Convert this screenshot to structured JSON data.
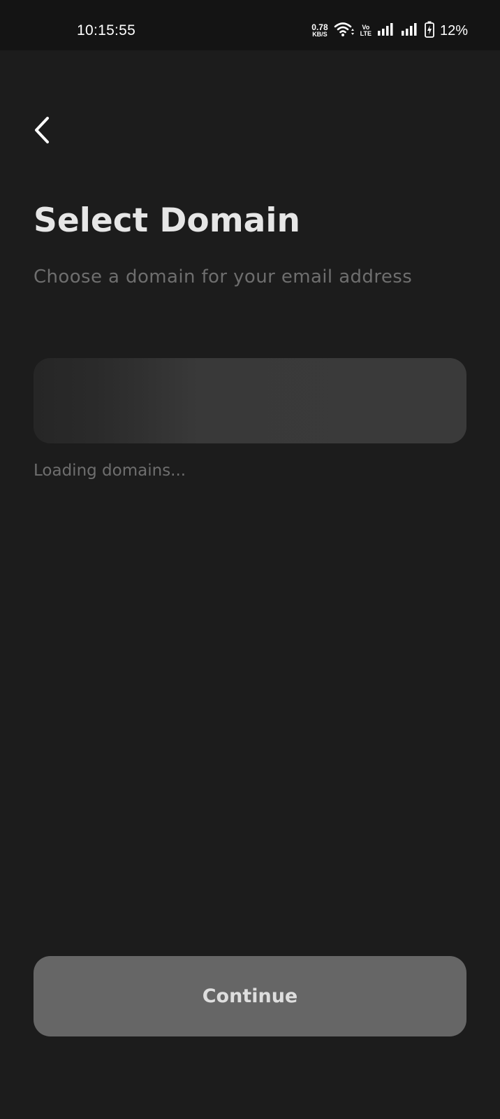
{
  "status_bar": {
    "time": "10:15:55",
    "net_speed_value": "0.78",
    "net_speed_unit": "KB/S",
    "volte_top": "Vo",
    "volte_bottom": "LTE",
    "battery_percent": "12%",
    "icons": [
      "wifi-icon",
      "signal-icon",
      "signal-icon",
      "battery-charging-icon"
    ]
  },
  "header": {
    "back_icon": "chevron-left-icon",
    "title": "Select Domain",
    "subtitle": "Choose a domain for your email address"
  },
  "domain_picker": {
    "state": "loading",
    "loading_text": "Loading domains..."
  },
  "footer": {
    "continue_label": "Continue"
  },
  "colors": {
    "background": "#1c1c1c",
    "status_bar": "#141414",
    "title": "#e6e6e6",
    "muted_text": "#6e6e6e",
    "skeleton": "#3a3a3a",
    "button_disabled": "#666666"
  }
}
